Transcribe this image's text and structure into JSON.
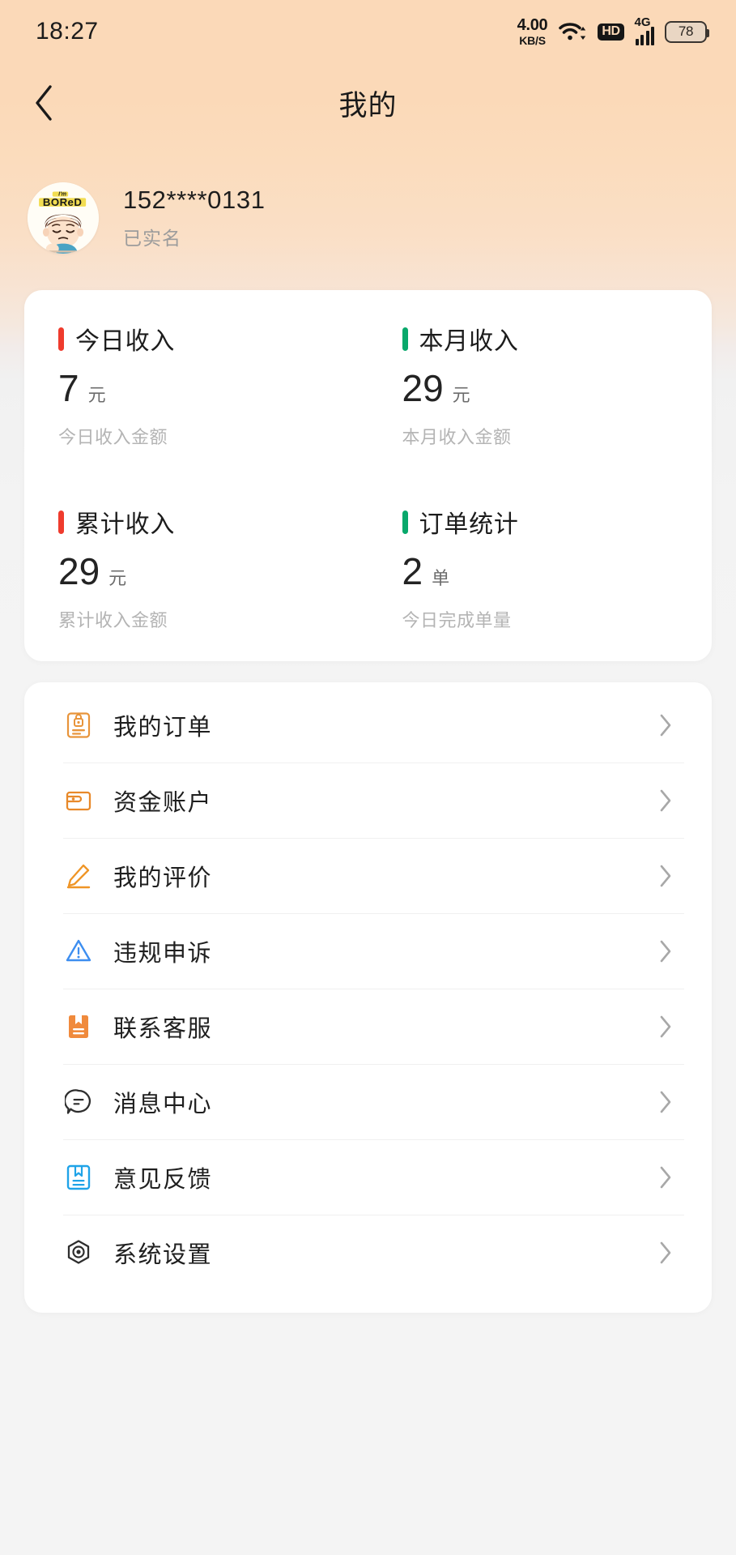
{
  "status_bar": {
    "time": "18:27",
    "net_speed_value": "4.00",
    "net_speed_unit": "KB/S",
    "wifi_icon": "wifi-icon",
    "hd_label": "HD",
    "network_type": "4G",
    "signal_icon": "signal-bars-icon",
    "battery_level": "78"
  },
  "nav": {
    "back_icon": "chevron-left-icon",
    "title": "我的"
  },
  "profile": {
    "avatar_icon": "user-avatar-bored-cartoon",
    "phone": "152****0131",
    "verified_label": "已实名"
  },
  "stats": [
    {
      "title": "今日收入",
      "value": "7",
      "unit": "元",
      "desc": "今日收入金额",
      "accent": "#ef3b2d"
    },
    {
      "title": "本月收入",
      "value": "29",
      "unit": "元",
      "desc": "本月收入金额",
      "accent": "#08a86b"
    },
    {
      "title": "累计收入",
      "value": "29",
      "unit": "元",
      "desc": "累计收入金额",
      "accent": "#ef3b2d"
    },
    {
      "title": "订单统计",
      "value": "2",
      "unit": "单",
      "desc": "今日完成单量",
      "accent": "#08a86b"
    }
  ],
  "menu": [
    {
      "label": "我的订单",
      "icon": "order-document-lock-icon",
      "color": "#e8943a"
    },
    {
      "label": "资金账户",
      "icon": "wallet-icon",
      "color": "#e8892a"
    },
    {
      "label": "我的评价",
      "icon": "pencil-edit-icon",
      "color": "#ef9526"
    },
    {
      "label": "违规申诉",
      "icon": "warning-triangle-icon",
      "color": "#3d8ef0"
    },
    {
      "label": "联系客服",
      "icon": "contact-service-book-icon",
      "color": "#f08a3c"
    },
    {
      "label": "消息中心",
      "icon": "message-bubble-icon",
      "color": "#2e2e2e"
    },
    {
      "label": "意见反馈",
      "icon": "feedback-book-icon",
      "color": "#1fa3e8"
    },
    {
      "label": "系统设置",
      "icon": "hexagon-settings-icon",
      "color": "#2e2e2e"
    }
  ],
  "chevron_icon": "chevron-right-icon"
}
